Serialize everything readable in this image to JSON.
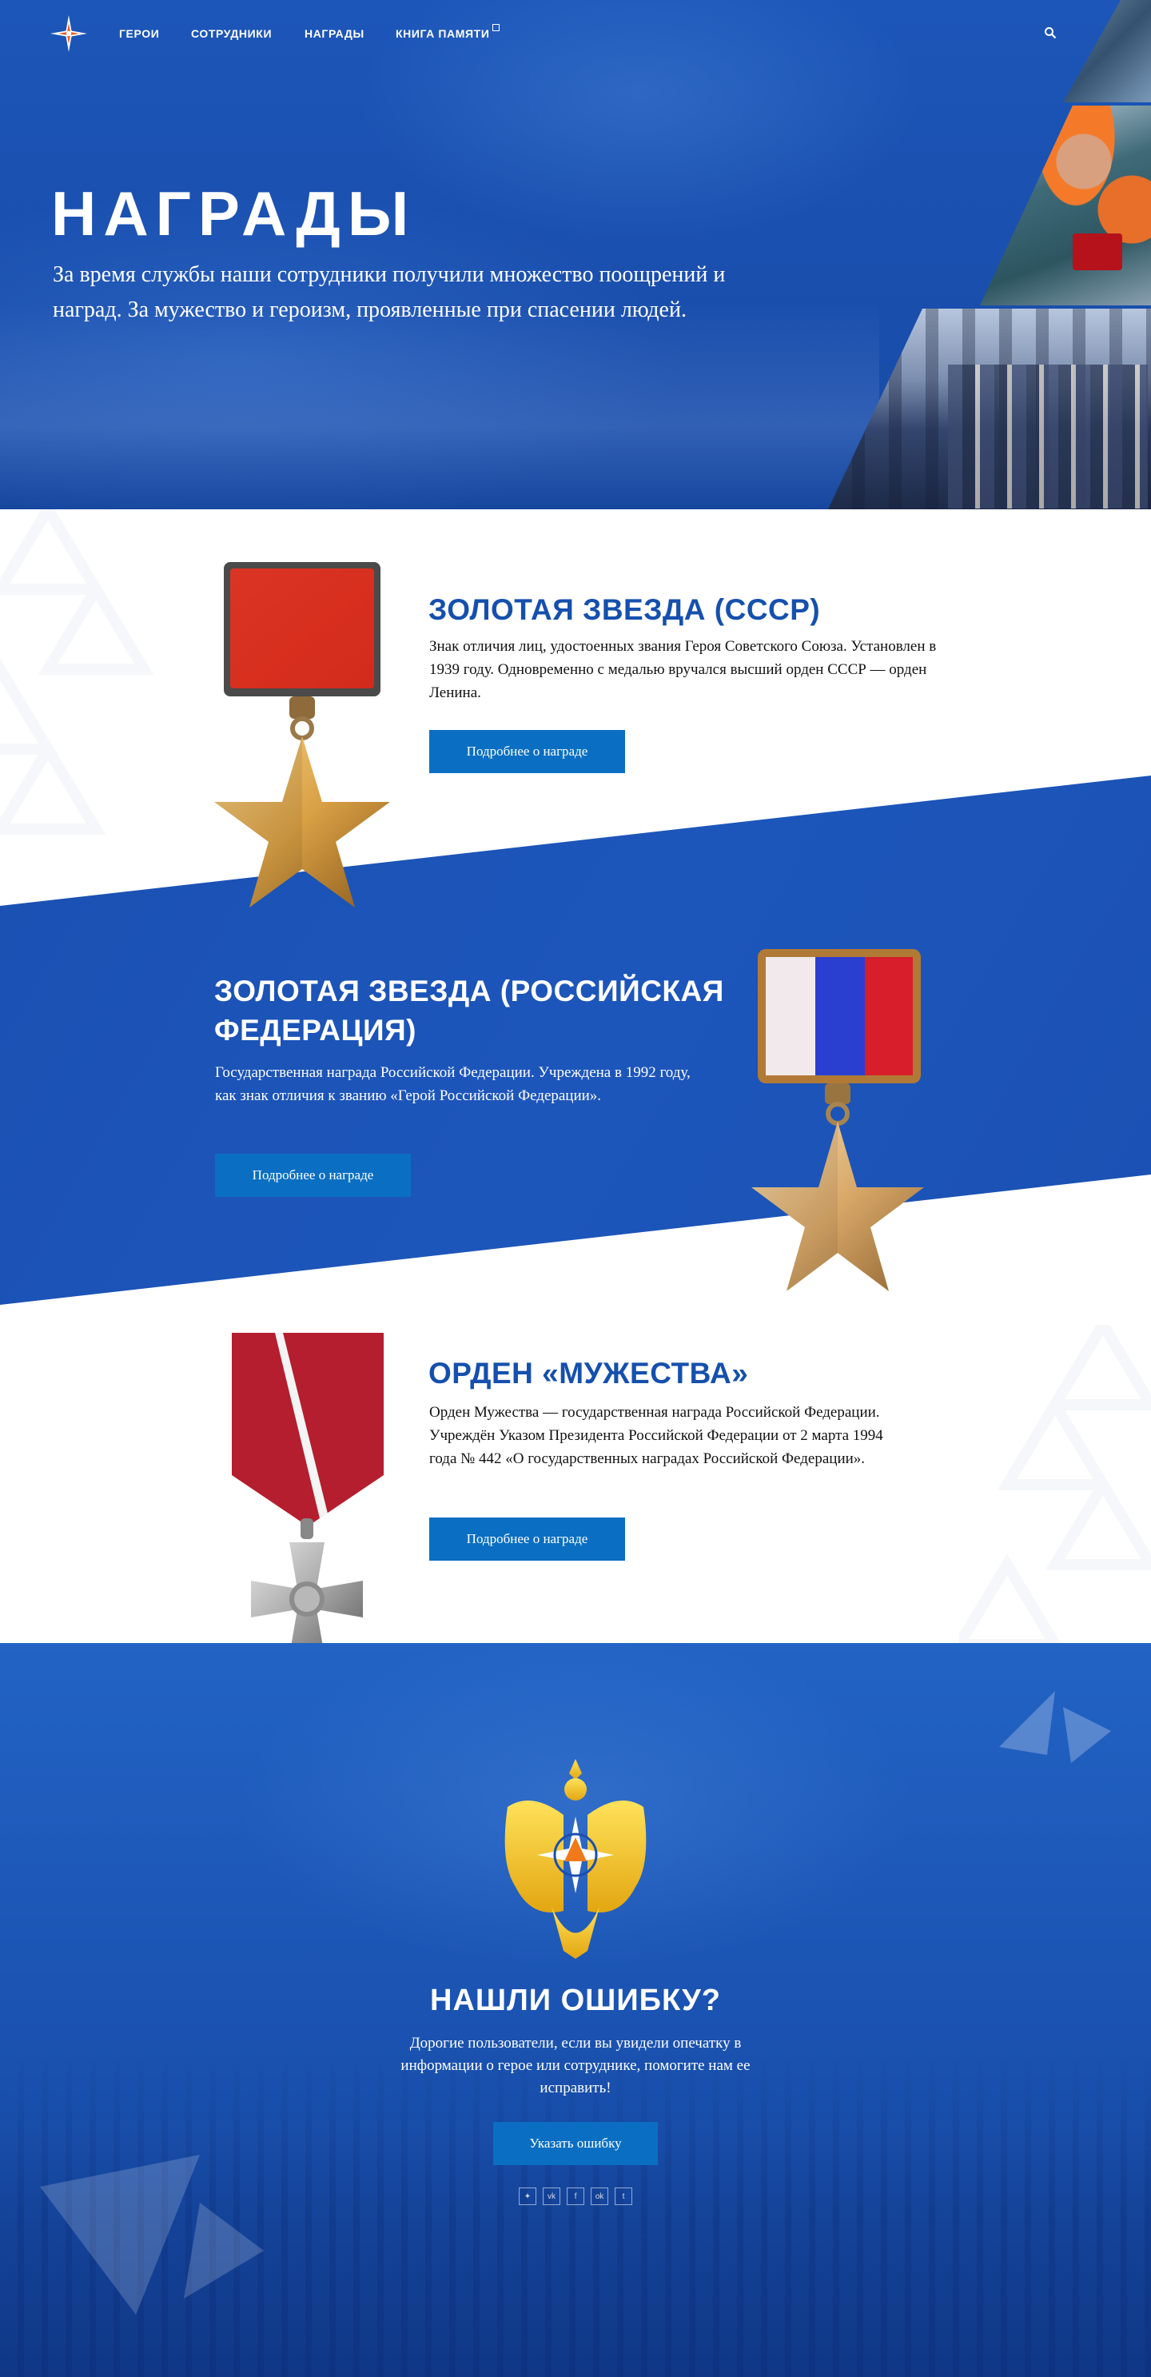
{
  "nav": {
    "items": [
      {
        "label": "ГЕРОИ"
      },
      {
        "label": "СОТРУДНИКИ"
      },
      {
        "label": "НАГРАДЫ"
      },
      {
        "label": "КНИГА ПАМЯТИ",
        "external": true
      }
    ],
    "search_icon": "search-icon",
    "logo_icon": "star-compass-icon"
  },
  "hero": {
    "title": "НАГРАДЫ",
    "subtitle": "За время службы наши сотрудники получили множество поощрений и наград. За мужество и героизм, проявленные при спасении людей."
  },
  "awards": [
    {
      "title": "ЗОЛОТАЯ ЗВЕЗДА (СССР)",
      "description": "Знак отличия лиц, удостоенных звания Героя Советского Союза. Установлен в 1939 году. Одновременно с медалью вручался высший орден СССР — орден Ленина.",
      "button": "Подробнее о награде"
    },
    {
      "title": "ЗОЛОТАЯ ЗВЕЗДА (РОССИЙСКАЯ ФЕДЕРАЦИЯ)",
      "description": "Государственная награда Российской Федерации. Учреждена в 1992 году, как знак отличия к званию «Герой Российской Федерации».",
      "button": "Подробнее о награде"
    },
    {
      "title": "ОРДЕН «МУЖЕСТВА»",
      "description": "Орден Мужества — государственная награда Российской Федерации. Учреждён Указом Президента Российской Федерации от 2 марта 1994 года № 442 «О государственных наградах Российской Федерации».",
      "button": "Подробнее о награде"
    }
  ],
  "footer": {
    "title": "НАШЛИ ОШИБКУ?",
    "text": "Дорогие пользователи, если вы увидели опечатку в информации о герое или сотруднике, помогите нам ее исправить!",
    "button": "Указать ошибку",
    "socials": [
      {
        "icon": "mchs-star-icon",
        "glyph": "✦"
      },
      {
        "icon": "vk-icon",
        "glyph": "vk"
      },
      {
        "icon": "facebook-icon",
        "glyph": "f"
      },
      {
        "icon": "odnoklassniki-icon",
        "glyph": "ok"
      },
      {
        "icon": "twitter-icon",
        "glyph": "t"
      }
    ]
  },
  "colors": {
    "brand_blue": "#1a4fb0",
    "button_blue": "#0a6fc2",
    "title_blue": "#1550ad",
    "ussr_ribbon": "#d8261c",
    "gold": "#d9a045"
  }
}
